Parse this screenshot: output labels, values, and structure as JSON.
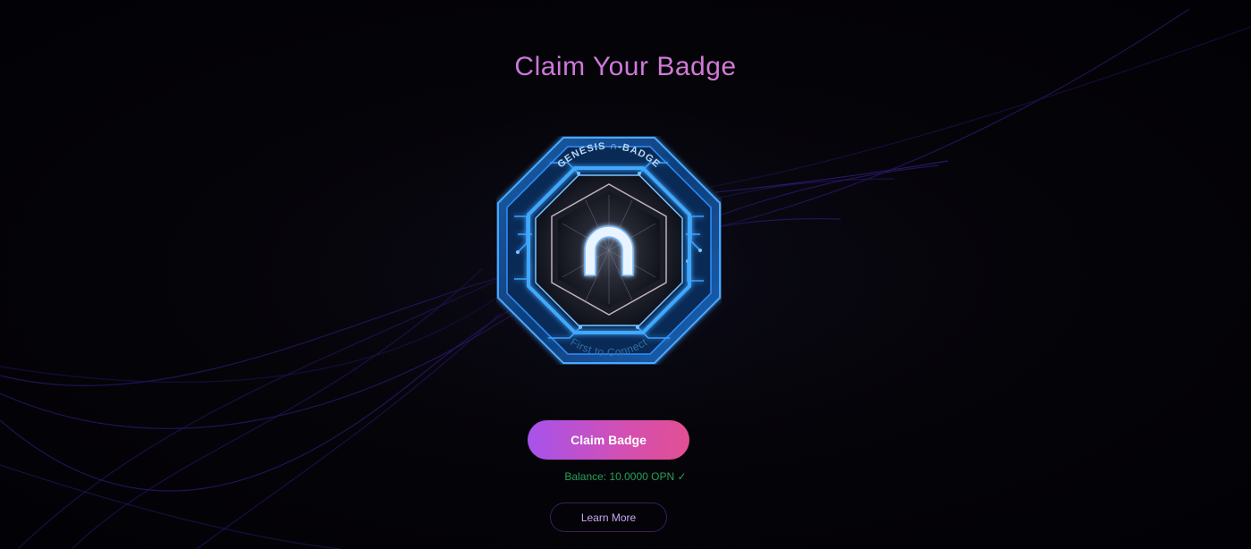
{
  "page": {
    "title": "Claim Your Badge"
  },
  "badge": {
    "top_text": "GENESIS ∩-BADGE",
    "bottom_text": "First to Connect",
    "icon": "n-logo-icon"
  },
  "actions": {
    "claim_label": "Claim Badge",
    "learn_more_label": "Learn More"
  },
  "status": {
    "balance_text": "Balance: 10.0000 OPN ✓"
  },
  "colors": {
    "background": "#030207",
    "title_gradient_start": "#b86ee8",
    "title_gradient_end": "#e080c4",
    "button_gradient_start": "#a653ec",
    "button_gradient_end": "#e24f93",
    "balance_green": "#27a05a",
    "badge_blue": "#2e8fff",
    "learn_more_border": "#3b1f5e"
  }
}
